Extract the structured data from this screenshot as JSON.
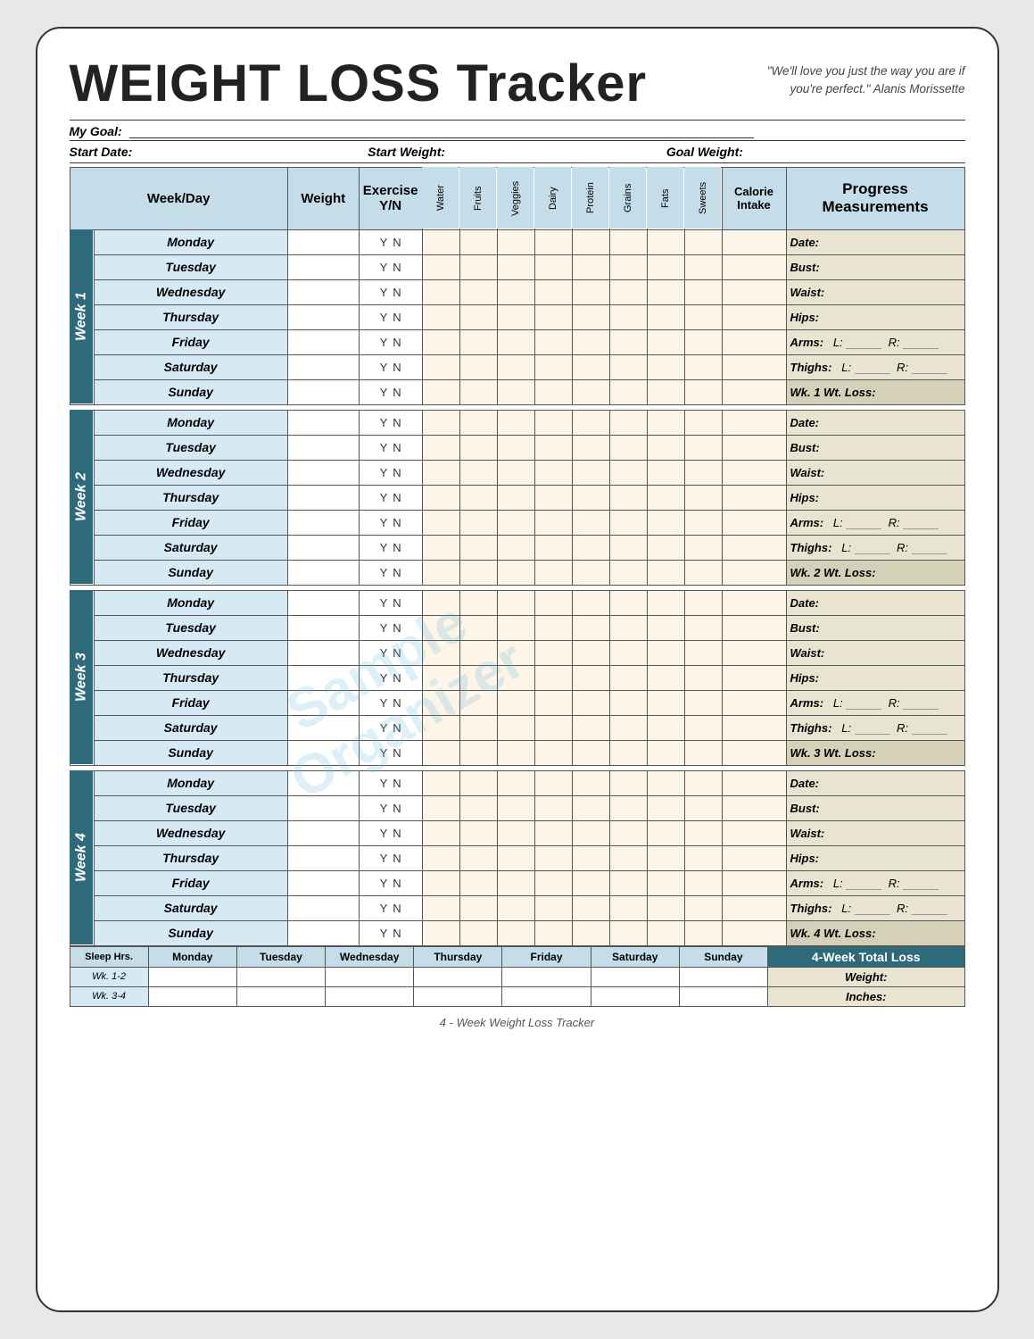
{
  "title": "WEIGHT LOSS Tracker",
  "quote": "\"We'll love you just the way you are if you're perfect.\"  Alanis Morissette",
  "goal_label": "My Goal:",
  "start_date_label": "Start Date:",
  "start_weight_label": "Start Weight:",
  "goal_weight_label": "Goal Weight:",
  "col_headers": {
    "week_day": "Week/Day",
    "weight": "Weight",
    "exercise": "Exercise Y/N",
    "water": "Water",
    "fruits": "Fruits",
    "veggies": "Veggies",
    "dairy": "Dairy",
    "protein": "Protein",
    "grains": "Grains",
    "fats": "Fats",
    "sweets": "Sweets",
    "calorie_intake": "Calorie Intake",
    "progress": "Progress Measurements"
  },
  "weeks": [
    {
      "label": "Week 1",
      "days": [
        "Monday",
        "Tuesday",
        "Wednesday",
        "Thursday",
        "Friday",
        "Saturday",
        "Sunday"
      ],
      "progress": {
        "date": "Date:",
        "bust": "Bust:",
        "waist": "Waist:",
        "hips": "Hips:",
        "arms": "Arms:",
        "arms_l": "L:",
        "arms_r": "R:",
        "thighs": "Thighs:",
        "thighs_l": "L:",
        "thighs_r": "R:",
        "wk_loss": "Wk. 1 Wt. Loss:"
      }
    },
    {
      "label": "Week 2",
      "days": [
        "Monday",
        "Tuesday",
        "Wednesday",
        "Thursday",
        "Friday",
        "Saturday",
        "Sunday"
      ],
      "progress": {
        "date": "Date:",
        "bust": "Bust:",
        "waist": "Waist:",
        "hips": "Hips:",
        "arms": "Arms:",
        "arms_l": "L:",
        "arms_r": "R:",
        "thighs": "Thighs:",
        "thighs_l": "L:",
        "thighs_r": "R:",
        "wk_loss": "Wk. 2 Wt. Loss:"
      }
    },
    {
      "label": "Week 3",
      "days": [
        "Monday",
        "Tuesday",
        "Wednesday",
        "Thursday",
        "Friday",
        "Saturday",
        "Sunday"
      ],
      "progress": {
        "date": "Date:",
        "bust": "Bust:",
        "waist": "Waist:",
        "hips": "Hips:",
        "arms": "Arms:",
        "arms_l": "L:",
        "arms_r": "R:",
        "thighs": "Thighs:",
        "thighs_l": "L:",
        "thighs_r": "R:",
        "wk_loss": "Wk. 3 Wt. Loss:"
      }
    },
    {
      "label": "Week 4",
      "days": [
        "Monday",
        "Tuesday",
        "Wednesday",
        "Thursday",
        "Friday",
        "Saturday",
        "Sunday"
      ],
      "progress": {
        "date": "Date:",
        "bust": "Bust:",
        "waist": "Waist:",
        "hips": "Hips:",
        "arms": "Arms:",
        "arms_l": "L:",
        "arms_r": "R:",
        "thighs": "Thighs:",
        "thighs_l": "L:",
        "thighs_r": "R:",
        "wk_loss": "Wk. 4 Wt. Loss:"
      }
    }
  ],
  "sleep_row": {
    "label": "Sleep Hrs.",
    "days": [
      "Monday",
      "Tuesday",
      "Wednesday",
      "Thursday",
      "Friday",
      "Saturday",
      "Sunday"
    ],
    "wk_rows": [
      "Wk. 1-2",
      "Wk. 3-4"
    ]
  },
  "four_week_total": "4-Week Total Loss",
  "total_weight": "Weight:",
  "total_inches": "Inches:",
  "footer": "4 - Week Weight Loss Tracker",
  "watermark_line1": "Sample",
  "watermark_line2": "Organizer",
  "yn_y": "Y",
  "yn_n": "N"
}
